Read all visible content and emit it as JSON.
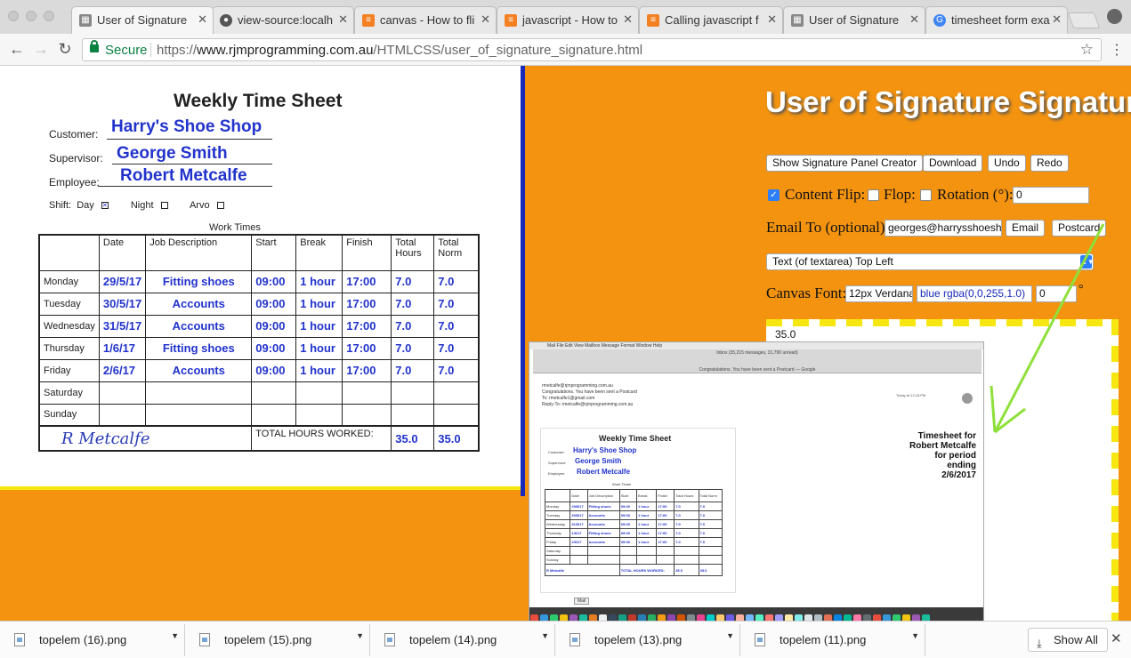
{
  "browser": {
    "tabs": [
      {
        "title": "User of Signature",
        "active": true
      },
      {
        "title": "view-source:localh",
        "active": false
      },
      {
        "title": "canvas - How to fli",
        "active": false
      },
      {
        "title": "javascript - How to",
        "active": false
      },
      {
        "title": "Calling javascript f",
        "active": false
      },
      {
        "title": "User of Signature",
        "active": false
      },
      {
        "title": "timesheet form exa",
        "active": false
      }
    ],
    "secure_label": "Secure",
    "url_prefix": "https://",
    "url_host": "www.rjmprogramming.com.au",
    "url_path": "/HTMLCSS/user_of_signature_signature.html"
  },
  "timesheet": {
    "title": "Weekly Time Sheet",
    "customer_label": "Customer:",
    "customer": "Harry's Shoe Shop",
    "supervisor_label": "Supervisor:",
    "supervisor": "George Smith",
    "employee_label": "Employee:",
    "employee": "Robert Metcalfe",
    "shift_label": "Shift:",
    "shift_day": "Day",
    "shift_night": "Night",
    "shift_arvo": "Arvo",
    "work_times_label": "Work Times",
    "headers": [
      "",
      "Date",
      "Job Description",
      "Start",
      "Break",
      "Finish",
      "Total Hours",
      "Total Norm"
    ],
    "rows": [
      [
        "Monday",
        "29/5/17",
        "Fitting shoes",
        "09:00",
        "1 hour",
        "17:00",
        "7.0",
        "7.0"
      ],
      [
        "Tuesday",
        "30/5/17",
        "Accounts",
        "09:00",
        "1 hour",
        "17:00",
        "7.0",
        "7.0"
      ],
      [
        "Wednesday",
        "31/5/17",
        "Accounts",
        "09:00",
        "1 hour",
        "17:00",
        "7.0",
        "7.0"
      ],
      [
        "Thursday",
        "1/6/17",
        "Fitting shoes",
        "09:00",
        "1 hour",
        "17:00",
        "7.0",
        "7.0"
      ],
      [
        "Friday",
        "2/6/17",
        "Accounts",
        "09:00",
        "1 hour",
        "17:00",
        "7.0",
        "7.0"
      ],
      [
        "Saturday",
        "",
        "",
        "",
        "",
        "",
        "",
        ""
      ],
      [
        "Sunday",
        "",
        "",
        "",
        "",
        "",
        "",
        ""
      ]
    ],
    "signature": "R Metcalfe",
    "total_label": "TOTAL HOURS WORKED:",
    "total_hours": "35.0",
    "total_norm": "35.0"
  },
  "panel": {
    "title": "User of Signature Signature",
    "btn_show_creator": "Show Signature Panel Creator",
    "btn_download": "Download",
    "btn_undo": "Undo",
    "btn_redo": "Redo",
    "content_flip_label": "Content Flip:",
    "content_flip_checked": true,
    "flop_label": "Flop:",
    "rotation_label": "Rotation (°):",
    "rotation_value": "0",
    "email_label": "Email To (optional):",
    "email_value": "georges@harrysshoeshop",
    "btn_email": "Email",
    "btn_postcard": "Postcard",
    "position_select": "Text (of textarea) Top Left",
    "canvas_font_label": "Canvas Font:",
    "font_value": "12px Verdana",
    "color_value": "blue rgba(0,0,255,1.0)",
    "angle_value": "0",
    "degree_symbol": "°",
    "canvas_total": "35.0"
  },
  "embedded_screenshot": {
    "menubar": "Mail  File  Edit  View  Mailbox  Message  Format  Window  Help",
    "window_title": "Inbox (35,215 messages, 31,790 unread)",
    "window_subtitle": "Congratulations. You have been sent a Postcard — Google",
    "mail_from": "rmetcalfe@rjmprogramming.com.au",
    "mail_subject": "Congratulations. You have been sent a Postcard",
    "mail_to": "To: rmetcalfe1@gmail.com",
    "mail_reply": "Reply-To: rmetcalfe@rjmprogramming.com.au",
    "mail_date": "Today at 12:18 PM",
    "memo": [
      "Timesheet for",
      "Robert Metcalfe",
      "for period ending",
      "2/6/2017"
    ],
    "dock_tag": "Mail"
  },
  "downloads": {
    "items": [
      "topelem (16).png",
      "topelem (15).png",
      "topelem (14).png",
      "topelem (13).png",
      "topelem (11).png"
    ],
    "show_all": "Show All"
  },
  "colors": {
    "page_bg": "#f39310",
    "ink_blue": "#2233cc",
    "arrow_green": "#8fe03a"
  }
}
